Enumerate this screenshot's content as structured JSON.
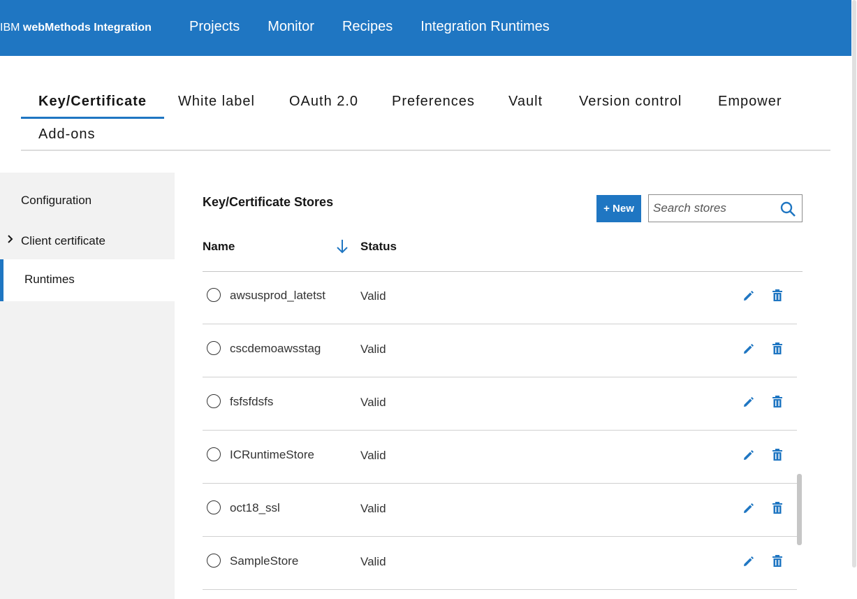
{
  "header": {
    "brand_ibm": "IBM",
    "brand_product": "webMethods Integration",
    "nav": [
      "Projects",
      "Monitor",
      "Recipes",
      "Integration Runtimes"
    ]
  },
  "tabs": [
    "Key/Certificate",
    "White label",
    "OAuth 2.0",
    "Preferences",
    "Vault",
    "Version control",
    "Empower",
    "Add-ons"
  ],
  "active_tab": "Key/Certificate",
  "sidebar": {
    "items": [
      {
        "label": "Configuration"
      },
      {
        "label": "Client certificate",
        "chevron": "chevron-right-icon"
      },
      {
        "label": "Runtimes",
        "active": true
      }
    ]
  },
  "main": {
    "title": "Key/Certificate Stores",
    "new_button": "+ New",
    "search_placeholder": "Search stores",
    "columns": {
      "name": "Name",
      "status": "Status"
    },
    "rows": [
      {
        "name": "awsusprod_latetst",
        "status": "Valid"
      },
      {
        "name": "cscdemoawsstag",
        "status": "Valid"
      },
      {
        "name": "fsfsfdsfs",
        "status": "Valid"
      },
      {
        "name": "ICRuntimeStore",
        "status": "Valid"
      },
      {
        "name": "oct18_ssl",
        "status": "Valid"
      },
      {
        "name": "SampleStore",
        "status": "Valid"
      }
    ]
  },
  "colors": {
    "accent": "#1f76c2",
    "sidebar_bg": "#f2f2f2"
  }
}
